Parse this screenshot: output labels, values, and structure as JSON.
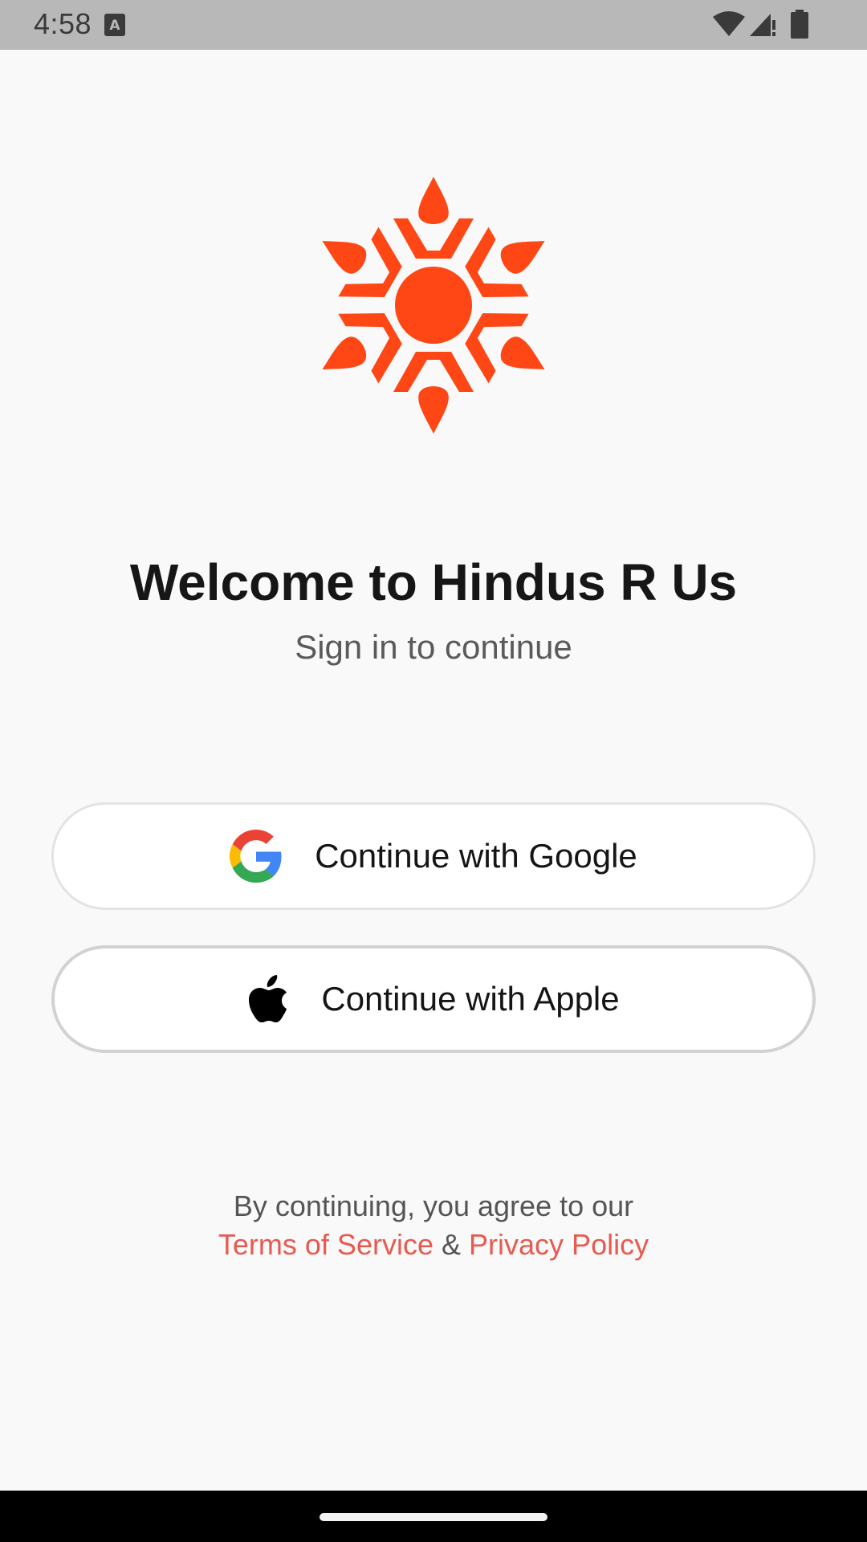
{
  "status_bar": {
    "time": "4:58",
    "icons": [
      "keyboard-a-icon",
      "wifi-icon",
      "signal-icon",
      "battery-icon"
    ]
  },
  "logo": {
    "icon": "sun-logo-icon",
    "color": "#ff4615"
  },
  "welcome": {
    "title": "Welcome to Hindus R Us",
    "subtitle": "Sign in to continue"
  },
  "auth": {
    "google_label": "Continue with Google",
    "apple_label": "Continue with Apple"
  },
  "legal": {
    "intro": "By continuing, you agree to our",
    "terms": "Terms of Service",
    "ampersand": "&",
    "privacy": "Privacy Policy",
    "link_color": "#e85a4f"
  }
}
